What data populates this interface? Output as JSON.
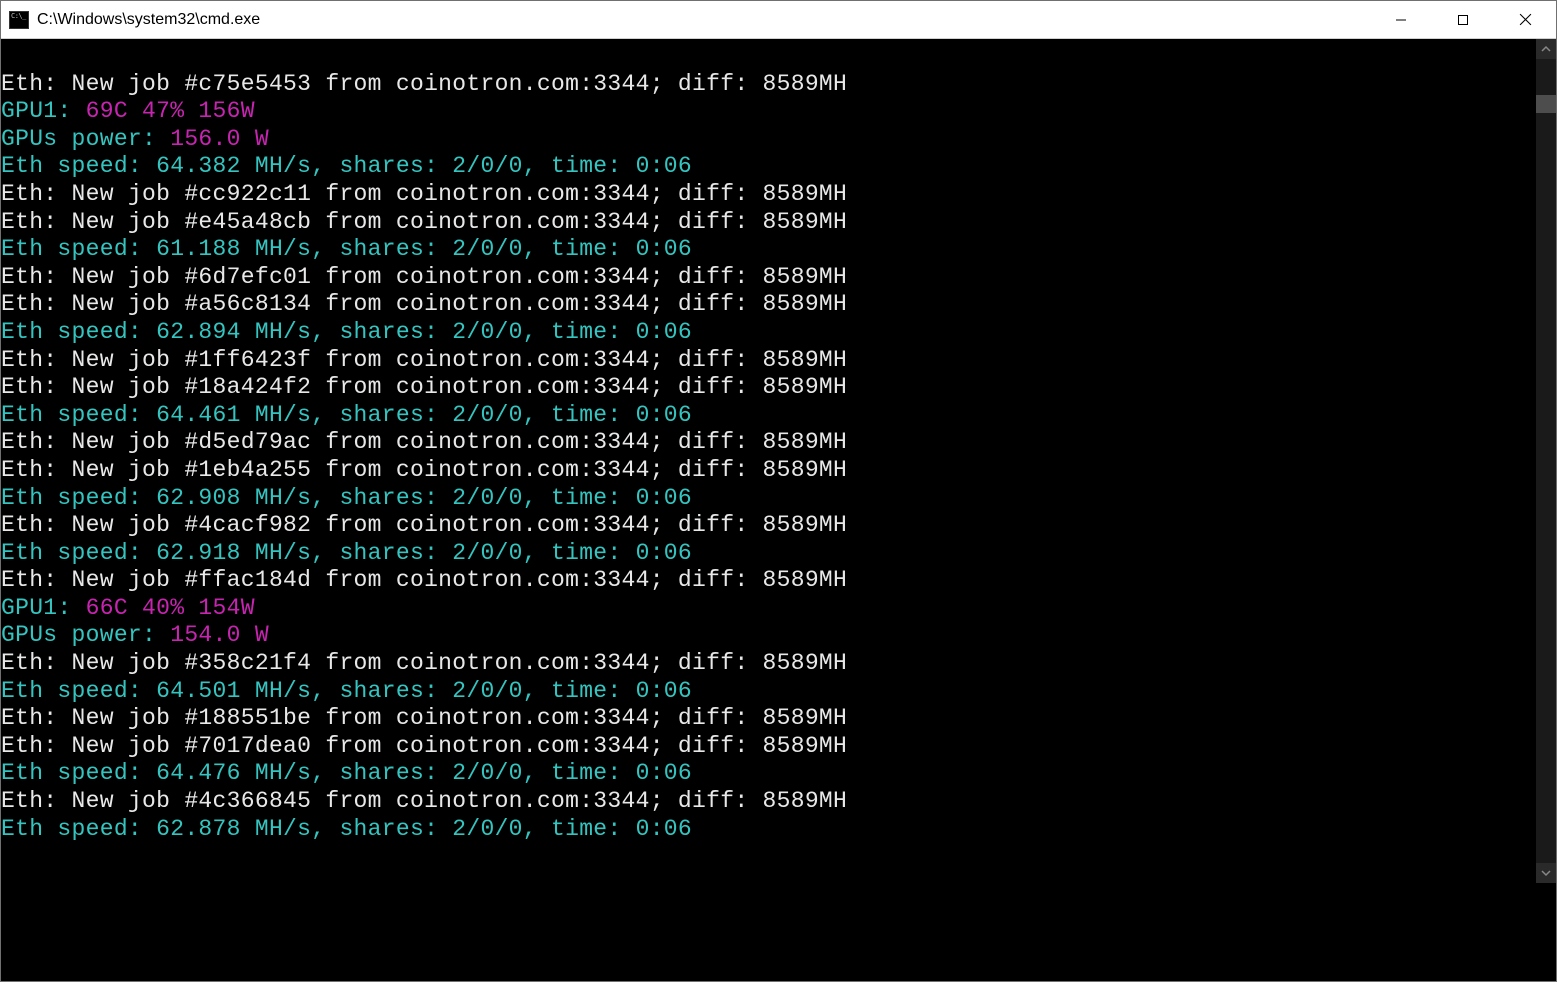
{
  "window": {
    "title": "C:\\Windows\\system32\\cmd.exe"
  },
  "terminal": {
    "lines": [
      {
        "type": "blank"
      },
      {
        "type": "job",
        "text": "Eth: New job #c75e5453 from coinotron.com:3344; diff: 8589MH"
      },
      {
        "type": "gpu1",
        "label": "GPU1:",
        "vals": " 69C 47% 156W"
      },
      {
        "type": "power",
        "label": "GPUs power:",
        "vals": " 156.0 W"
      },
      {
        "type": "speed",
        "text": "Eth speed: 64.382 MH/s, shares: 2/0/0, time: 0:06"
      },
      {
        "type": "job",
        "text": "Eth: New job #cc922c11 from coinotron.com:3344; diff: 8589MH"
      },
      {
        "type": "job",
        "text": "Eth: New job #e45a48cb from coinotron.com:3344; diff: 8589MH"
      },
      {
        "type": "speed",
        "text": "Eth speed: 61.188 MH/s, shares: 2/0/0, time: 0:06"
      },
      {
        "type": "job",
        "text": "Eth: New job #6d7efc01 from coinotron.com:3344; diff: 8589MH"
      },
      {
        "type": "job",
        "text": "Eth: New job #a56c8134 from coinotron.com:3344; diff: 8589MH"
      },
      {
        "type": "speed",
        "text": "Eth speed: 62.894 MH/s, shares: 2/0/0, time: 0:06"
      },
      {
        "type": "job",
        "text": "Eth: New job #1ff6423f from coinotron.com:3344; diff: 8589MH"
      },
      {
        "type": "job",
        "text": "Eth: New job #18a424f2 from coinotron.com:3344; diff: 8589MH"
      },
      {
        "type": "speed",
        "text": "Eth speed: 64.461 MH/s, shares: 2/0/0, time: 0:06"
      },
      {
        "type": "job",
        "text": "Eth: New job #d5ed79ac from coinotron.com:3344; diff: 8589MH"
      },
      {
        "type": "job",
        "text": "Eth: New job #1eb4a255 from coinotron.com:3344; diff: 8589MH"
      },
      {
        "type": "speed",
        "text": "Eth speed: 62.908 MH/s, shares: 2/0/0, time: 0:06"
      },
      {
        "type": "job",
        "text": "Eth: New job #4cacf982 from coinotron.com:3344; diff: 8589MH"
      },
      {
        "type": "speed",
        "text": "Eth speed: 62.918 MH/s, shares: 2/0/0, time: 0:06"
      },
      {
        "type": "job",
        "text": "Eth: New job #ffac184d from coinotron.com:3344; diff: 8589MH"
      },
      {
        "type": "gpu1",
        "label": "GPU1:",
        "vals": " 66C 40% 154W"
      },
      {
        "type": "power",
        "label": "GPUs power:",
        "vals": " 154.0 W"
      },
      {
        "type": "job",
        "text": "Eth: New job #358c21f4 from coinotron.com:3344; diff: 8589MH"
      },
      {
        "type": "speed",
        "text": "Eth speed: 64.501 MH/s, shares: 2/0/0, time: 0:06"
      },
      {
        "type": "job",
        "text": "Eth: New job #188551be from coinotron.com:3344; diff: 8589MH"
      },
      {
        "type": "job",
        "text": "Eth: New job #7017dea0 from coinotron.com:3344; diff: 8589MH"
      },
      {
        "type": "speed",
        "text": "Eth speed: 64.476 MH/s, shares: 2/0/0, time: 0:06"
      },
      {
        "type": "job",
        "text": "Eth: New job #4c366845 from coinotron.com:3344; diff: 8589MH"
      },
      {
        "type": "speed",
        "text": "Eth speed: 62.878 MH/s, shares: 2/0/0, time: 0:06"
      }
    ]
  }
}
